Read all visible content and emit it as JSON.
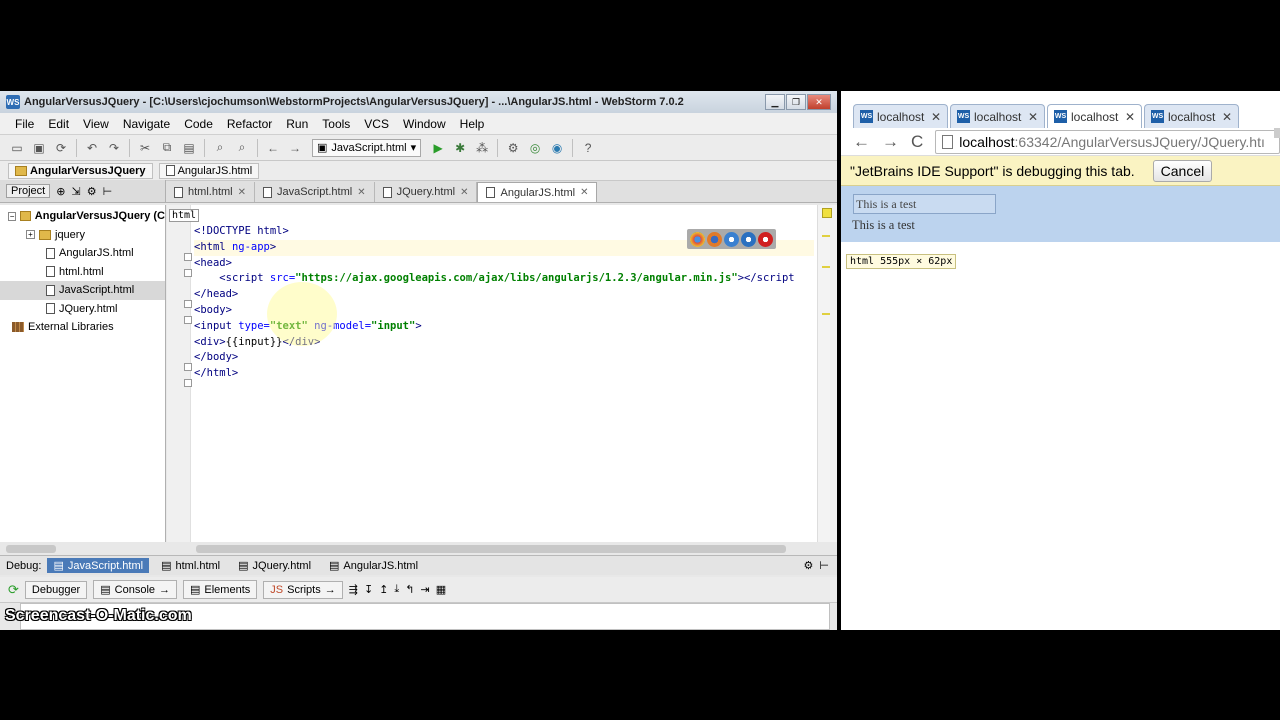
{
  "ide": {
    "title": "AngularVersusJQuery - [C:\\Users\\cjochumson\\WebstormProjects\\AngularVersusJQuery] - ...\\AngularJS.html - WebStorm 7.0.2",
    "menu": [
      "File",
      "Edit",
      "View",
      "Navigate",
      "Code",
      "Refactor",
      "Run",
      "Tools",
      "VCS",
      "Window",
      "Help"
    ],
    "run_config": "JavaScript.html",
    "breadcrumbs": [
      "AngularVersusJQuery",
      "AngularJS.html"
    ],
    "project_tab": "Project",
    "file_tabs": [
      "html.html",
      "JavaScript.html",
      "JQuery.html",
      "AngularJS.html"
    ],
    "active_tab": "AngularJS.html",
    "tree": {
      "root": "AngularVersusJQuery (C",
      "items": [
        "jquery",
        "AngularJS.html",
        "html.html",
        "JavaScript.html",
        "JQuery.html"
      ],
      "external": "External Libraries"
    },
    "editor_crumb": "html",
    "code": [
      [
        {
          "c": "t-tag",
          "t": "<!DOCTYPE html>"
        }
      ],
      [
        {
          "c": "t-tag",
          "t": "<html "
        },
        {
          "c": "t-attr",
          "t": "ng-app"
        },
        {
          "c": "t-tag",
          "t": ">"
        }
      ],
      [
        {
          "c": "t-tag",
          "t": "<head>"
        }
      ],
      [
        {
          "c": "t-plain",
          "t": "    "
        },
        {
          "c": "t-tag",
          "t": "<script "
        },
        {
          "c": "t-attr",
          "t": "src="
        },
        {
          "c": "t-str",
          "t": "\"https://ajax.googleapis.com/ajax/libs/angularjs/1.2.3/angular.min.js\""
        },
        {
          "c": "t-tag",
          "t": "></script"
        }
      ],
      [
        {
          "c": "t-tag",
          "t": "</head>"
        }
      ],
      [
        {
          "c": "t-tag",
          "t": "<body>"
        }
      ],
      [
        {
          "c": "t-tag",
          "t": "<input "
        },
        {
          "c": "t-attr",
          "t": "type="
        },
        {
          "c": "t-str",
          "t": "\"text\""
        },
        {
          "c": "t-plain",
          "t": " "
        },
        {
          "c": "t-attr",
          "t": "ng-model="
        },
        {
          "c": "t-str",
          "t": "\"input\""
        },
        {
          "c": "t-tag",
          "t": ">"
        }
      ],
      [
        {
          "c": "t-tag",
          "t": "<div>"
        },
        {
          "c": "t-plain",
          "t": "{{input}}"
        },
        {
          "c": "t-tag",
          "t": "</div>"
        }
      ],
      [
        {
          "c": "t-tag",
          "t": "</body>"
        }
      ],
      [
        {
          "c": "t-tag",
          "t": "</html>"
        }
      ]
    ],
    "debug_label": "Debug:",
    "debug_tabs": [
      "JavaScript.html",
      "html.html",
      "JQuery.html",
      "AngularJS.html"
    ],
    "debug_buttons": [
      "Debugger",
      "Console",
      "Elements",
      "Scripts"
    ]
  },
  "browser": {
    "tabs": [
      "localhost",
      "localhost",
      "localhost",
      "localhost"
    ],
    "active_tab_index": 2,
    "url_host": "localhost",
    "url_rest": ":63342/AngularVersusJQuery/JQuery.htı",
    "debug_notice": "\"JetBrains IDE Support\" is debugging this tab.",
    "cancel_label": "Cancel",
    "input_value": "This is a test",
    "echo_text": "This is a test",
    "size_tooltip": "html 555px × 62px"
  },
  "watermark": "Screencast-O-Matic.com",
  "colors": {
    "editor_current_line": "#fffae3",
    "string_green": "#008000",
    "page_highlight": "#bcd3ee",
    "notice_bar": "#faf3c2"
  }
}
